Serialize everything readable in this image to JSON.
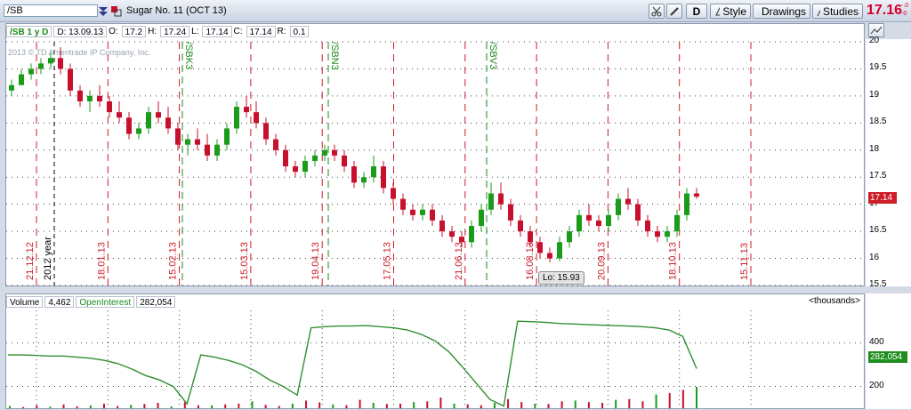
{
  "toolbar": {
    "symbol": "/SB",
    "title": "Sugar No. 11 (OCT 13)",
    "d_label": "D",
    "style_label": "Style",
    "drawings_label": "Drawings",
    "studies_label": "Studies",
    "last_price": "17.16",
    "change_top": "-.0",
    "change_bottom": "-0"
  },
  "infobar": {
    "symbol_period": "/SB 1 y D",
    "d": "D: 13.09.13",
    "o_label": "O:",
    "o": "17.2",
    "h_label": "H:",
    "h": "17.24",
    "l_label": "L:",
    "l": "17.14",
    "c_label": "C:",
    "c": "17.14",
    "r_label": "R:",
    "r": "0.1"
  },
  "watermark": "2013 © TD Ameritrade IP Company, Inc.",
  "year_label": "2012 year",
  "low_callout": "Lo: 15.93",
  "price_tag": "17.14",
  "volume_bar": {
    "volume_label": "Volume",
    "volume_value": "4,462",
    "oi_label": "OpenInterest",
    "oi_value": "282,054",
    "units": "<thousands>"
  },
  "oi_tag": "282,054",
  "price_axis": [
    "20",
    "19.5",
    "19",
    "18.5",
    "18",
    "17.5",
    "17",
    "16.5",
    "16",
    "15.5"
  ],
  "volume_axis": [
    "400",
    "200"
  ],
  "date_labels": [
    "21.12.12",
    "18.01.13",
    "15.02.13",
    "15.03.13",
    "19.04.13",
    "17.05.13",
    "21.06.13",
    "16.08.13",
    "20.09.13",
    "18.10.13",
    "15.11.13"
  ],
  "rollover_labels": [
    "/SBK3",
    "/SBN3",
    "/SBV3"
  ],
  "colors": {
    "up": "#1a9c1a",
    "down": "#c8102e",
    "oi_line": "#2f8f2f",
    "grid": "#444444"
  },
  "chart_data": {
    "type": "candlestick",
    "price_ylim": [
      15.5,
      20
    ],
    "price_candles": [
      [
        19.1,
        19.3,
        19.0,
        19.2
      ],
      [
        19.2,
        19.5,
        19.2,
        19.4
      ],
      [
        19.4,
        19.6,
        19.3,
        19.5
      ],
      [
        19.5,
        19.7,
        19.4,
        19.6
      ],
      [
        19.6,
        19.8,
        19.5,
        19.7
      ],
      [
        19.7,
        19.9,
        19.4,
        19.5
      ],
      [
        19.5,
        19.6,
        19.0,
        19.1
      ],
      [
        19.1,
        19.2,
        18.8,
        18.9
      ],
      [
        18.9,
        19.1,
        18.7,
        19.0
      ],
      [
        19.0,
        19.2,
        18.8,
        18.9
      ],
      [
        18.9,
        19.0,
        18.6,
        18.7
      ],
      [
        18.7,
        18.9,
        18.5,
        18.6
      ],
      [
        18.6,
        18.7,
        18.2,
        18.3
      ],
      [
        18.3,
        18.5,
        18.2,
        18.4
      ],
      [
        18.4,
        18.8,
        18.3,
        18.7
      ],
      [
        18.7,
        18.9,
        18.5,
        18.6
      ],
      [
        18.6,
        18.8,
        18.3,
        18.4
      ],
      [
        18.4,
        18.5,
        18.0,
        18.1
      ],
      [
        18.1,
        18.3,
        17.9,
        18.2
      ],
      [
        18.2,
        18.4,
        18.0,
        18.1
      ],
      [
        18.1,
        18.3,
        17.8,
        17.9
      ],
      [
        17.9,
        18.2,
        17.8,
        18.1
      ],
      [
        18.1,
        18.5,
        18.0,
        18.4
      ],
      [
        18.4,
        18.9,
        18.3,
        18.8
      ],
      [
        18.8,
        19.0,
        18.6,
        18.7
      ],
      [
        18.7,
        18.9,
        18.4,
        18.5
      ],
      [
        18.5,
        18.6,
        18.1,
        18.2
      ],
      [
        18.2,
        18.3,
        17.9,
        18.0
      ],
      [
        18.0,
        18.1,
        17.6,
        17.7
      ],
      [
        17.7,
        17.8,
        17.5,
        17.6
      ],
      [
        17.6,
        17.9,
        17.5,
        17.8
      ],
      [
        17.8,
        18.0,
        17.7,
        17.9
      ],
      [
        17.9,
        18.1,
        17.8,
        18.0
      ],
      [
        18.0,
        18.1,
        17.8,
        17.9
      ],
      [
        17.9,
        18.0,
        17.6,
        17.7
      ],
      [
        17.7,
        17.8,
        17.3,
        17.4
      ],
      [
        17.4,
        17.6,
        17.3,
        17.5
      ],
      [
        17.5,
        17.9,
        17.4,
        17.7
      ],
      [
        17.7,
        17.8,
        17.2,
        17.3
      ],
      [
        17.3,
        17.4,
        17.0,
        17.1
      ],
      [
        17.1,
        17.2,
        16.8,
        16.9
      ],
      [
        16.9,
        17.0,
        16.7,
        16.8
      ],
      [
        16.8,
        17.0,
        16.7,
        16.9
      ],
      [
        16.9,
        17.0,
        16.6,
        16.7
      ],
      [
        16.7,
        16.8,
        16.4,
        16.5
      ],
      [
        16.5,
        16.6,
        16.3,
        16.4
      ],
      [
        16.4,
        16.5,
        16.2,
        16.3
      ],
      [
        16.3,
        16.7,
        16.2,
        16.6
      ],
      [
        16.6,
        17.0,
        16.5,
        16.9
      ],
      [
        16.9,
        17.4,
        16.8,
        17.2
      ],
      [
        17.2,
        17.4,
        16.9,
        17.0
      ],
      [
        17.0,
        17.1,
        16.6,
        16.7
      ],
      [
        16.7,
        16.8,
        16.4,
        16.5
      ],
      [
        16.5,
        16.6,
        16.2,
        16.3
      ],
      [
        16.3,
        16.4,
        16.0,
        16.1
      ],
      [
        16.1,
        16.2,
        15.93,
        16.0
      ],
      [
        16.0,
        16.4,
        15.95,
        16.3
      ],
      [
        16.3,
        16.6,
        16.2,
        16.5
      ],
      [
        16.5,
        16.9,
        16.4,
        16.8
      ],
      [
        16.8,
        17.0,
        16.6,
        16.7
      ],
      [
        16.7,
        16.8,
        16.5,
        16.6
      ],
      [
        16.6,
        16.9,
        16.5,
        16.8
      ],
      [
        16.8,
        17.2,
        16.7,
        17.1
      ],
      [
        17.1,
        17.3,
        16.9,
        17.0
      ],
      [
        17.0,
        17.1,
        16.6,
        16.7
      ],
      [
        16.7,
        16.8,
        16.4,
        16.5
      ],
      [
        16.5,
        16.6,
        16.3,
        16.4
      ],
      [
        16.4,
        16.6,
        16.3,
        16.5
      ],
      [
        16.5,
        16.9,
        16.4,
        16.8
      ],
      [
        16.8,
        17.3,
        16.7,
        17.2
      ],
      [
        17.2,
        17.3,
        17.1,
        17.14
      ]
    ],
    "open_interest_ylim": [
      100,
      550
    ],
    "open_interest": [
      345,
      345,
      343,
      340,
      340,
      335,
      330,
      320,
      305,
      280,
      250,
      230,
      200,
      120,
      345,
      335,
      320,
      300,
      270,
      230,
      200,
      160,
      470,
      475,
      478,
      478,
      480,
      475,
      470,
      460,
      440,
      410,
      360,
      290,
      215,
      140,
      110,
      500,
      498,
      495,
      490,
      488,
      485,
      482,
      480,
      478,
      475,
      470,
      460,
      430,
      282
    ],
    "volume": [
      15,
      8,
      20,
      10,
      25,
      12,
      18,
      30,
      14,
      22,
      28,
      35,
      12,
      40,
      20,
      18,
      25,
      30,
      45,
      22,
      15,
      30,
      50,
      38,
      25,
      20,
      55,
      35,
      28,
      30,
      40,
      45,
      70,
      30,
      25,
      20,
      35,
      60,
      40,
      30,
      28,
      45,
      50,
      40,
      35,
      55,
      60,
      45,
      90,
      100,
      120,
      140
    ]
  }
}
